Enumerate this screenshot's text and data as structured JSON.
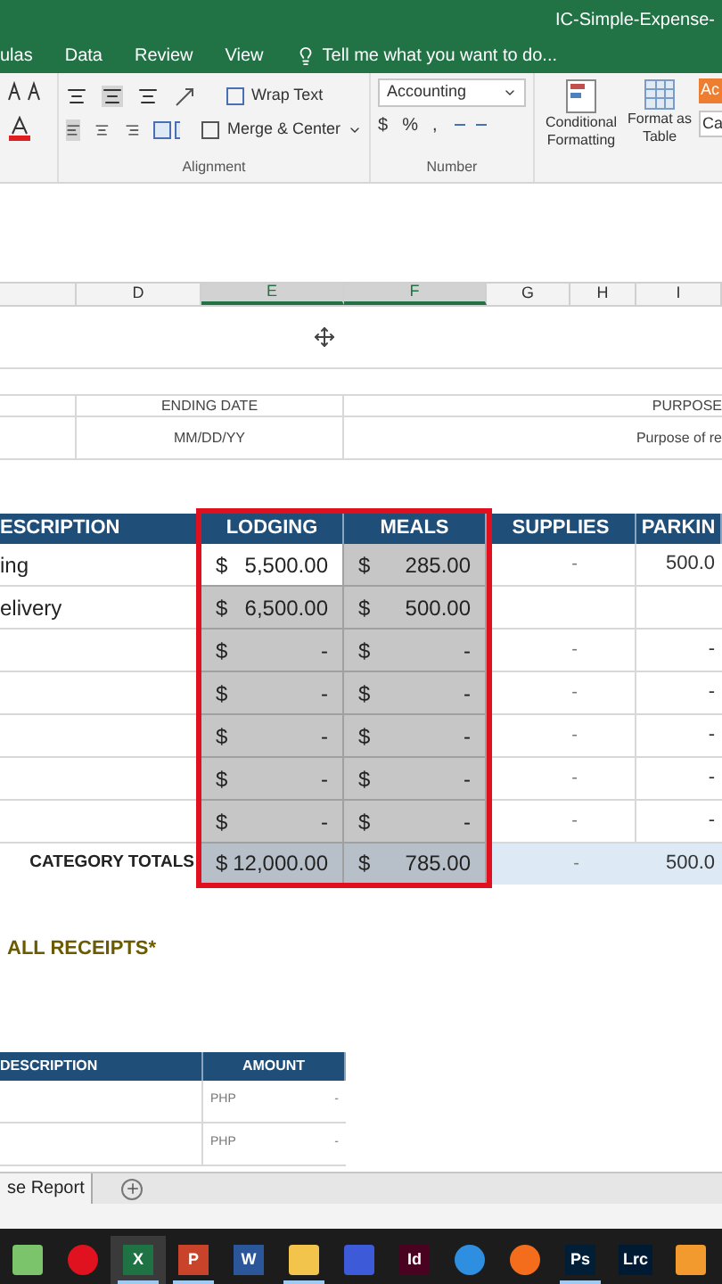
{
  "title_bar": {
    "title": "IC-Simple-Expense-"
  },
  "menu_tabs": [
    {
      "label": "ulas"
    },
    {
      "label": "Data"
    },
    {
      "label": "Review"
    },
    {
      "label": "View"
    }
  ],
  "tell_me": {
    "placeholder": "Tell me what you want to do..."
  },
  "ribbon": {
    "wrap_text": "Wrap Text",
    "merge_center": "Merge & Center",
    "alignment_label": "Alignment",
    "number_format": "Accounting",
    "currency": "$",
    "percent": "%",
    "comma": ",",
    "number_label": "Number",
    "conditional_formatting": "Conditional Formatting",
    "format_as_table": "Format as Table",
    "cell_styles": [
      "Ac",
      "Ca"
    ]
  },
  "column_headers": [
    {
      "label": "D",
      "selected": false
    },
    {
      "label": "E",
      "selected": true
    },
    {
      "label": "F",
      "selected": true
    },
    {
      "label": "G",
      "selected": false
    },
    {
      "label": "H",
      "selected": false
    },
    {
      "label": "I",
      "selected": false
    }
  ],
  "info": {
    "ending_date_label": "ENDING DATE",
    "ending_date": "MM/DD/YY",
    "purpose_label": "PURPOSE",
    "purpose": "Purpose of re"
  },
  "expense_table": {
    "columns": [
      "ESCRIPTION",
      "LODGING",
      "MEALS",
      "SUPPLIES",
      "PARKIN"
    ],
    "rows": [
      {
        "description": "ing",
        "lodging": {
          "currency": "$",
          "amount": "5,500.00",
          "selected": true,
          "active": true
        },
        "meals": {
          "currency": "$",
          "amount": "285.00",
          "selected": true,
          "active": false
        },
        "supplies": "-",
        "parking": "500.0"
      },
      {
        "description": "elivery",
        "lodging": {
          "currency": "$",
          "amount": "6,500.00",
          "selected": true,
          "active": false
        },
        "meals": {
          "currency": "$",
          "amount": "500.00",
          "selected": true,
          "active": false
        }
      },
      {
        "lodging": {
          "currency": "$",
          "amount": "-",
          "selected": true,
          "active": false
        },
        "meals": {
          "currency": "$",
          "amount": "-",
          "selected": true,
          "active": false
        },
        "supplies": "-",
        "parking": "-"
      },
      {
        "lodging": {
          "currency": "$",
          "amount": "-",
          "selected": true,
          "active": false
        },
        "meals": {
          "currency": "$",
          "amount": "-",
          "selected": true,
          "active": false
        },
        "supplies": "-",
        "parking": "-"
      },
      {
        "lodging": {
          "currency": "$",
          "amount": "-",
          "selected": true,
          "active": false
        },
        "meals": {
          "currency": "$",
          "amount": "-",
          "selected": true,
          "active": false
        },
        "supplies": "-",
        "parking": "-"
      },
      {
        "lodging": {
          "currency": "$",
          "amount": "-",
          "selected": true,
          "active": false
        },
        "meals": {
          "currency": "$",
          "amount": "-",
          "selected": true,
          "active": false
        },
        "supplies": "-",
        "parking": "-"
      },
      {
        "lodging": {
          "currency": "$",
          "amount": "-",
          "selected": true,
          "active": false
        },
        "meals": {
          "currency": "$",
          "amount": "-",
          "selected": true,
          "active": false
        },
        "supplies": "-",
        "parking": "-"
      }
    ],
    "totals": {
      "label": "CATEGORY TOTALS",
      "lodging": {
        "currency": "$",
        "amount": "12,000.00"
      },
      "meals": {
        "currency": "$",
        "amount": "785.00"
      },
      "supplies": "-",
      "parking": "500.0"
    }
  },
  "receipts_note": "ALL RECEIPTS*",
  "receipts_table": {
    "columns": [
      "DESCRIPTION",
      "AMOUNT"
    ],
    "rows": [
      {
        "currency": "PHP",
        "amount": "-"
      },
      {
        "currency": "PHP",
        "amount": "-"
      }
    ]
  },
  "sheet_tabs": [
    {
      "label": "se Report",
      "selected": true
    }
  ],
  "taskbar": [
    {
      "kind": "plant",
      "running": false,
      "active": false
    },
    {
      "kind": "opera",
      "running": false,
      "active": false
    },
    {
      "kind": "excel",
      "label": "X",
      "running": true,
      "active": true
    },
    {
      "kind": "powerpoint",
      "label": "P",
      "running": true,
      "active": false
    },
    {
      "kind": "word",
      "label": "W",
      "running": false,
      "active": false
    },
    {
      "kind": "folder",
      "running": true,
      "active": false
    },
    {
      "kind": "scanner",
      "running": false,
      "active": false
    },
    {
      "kind": "indesign",
      "label": "Id",
      "running": false,
      "active": false
    },
    {
      "kind": "sync",
      "running": false,
      "active": false
    },
    {
      "kind": "firefox",
      "running": false,
      "active": false
    },
    {
      "kind": "photoshop",
      "label": "Ps",
      "running": true,
      "active": false
    },
    {
      "kind": "lightroom",
      "label": "Lrc",
      "running": false,
      "active": false
    },
    {
      "kind": "player",
      "running": false,
      "active": false
    }
  ]
}
